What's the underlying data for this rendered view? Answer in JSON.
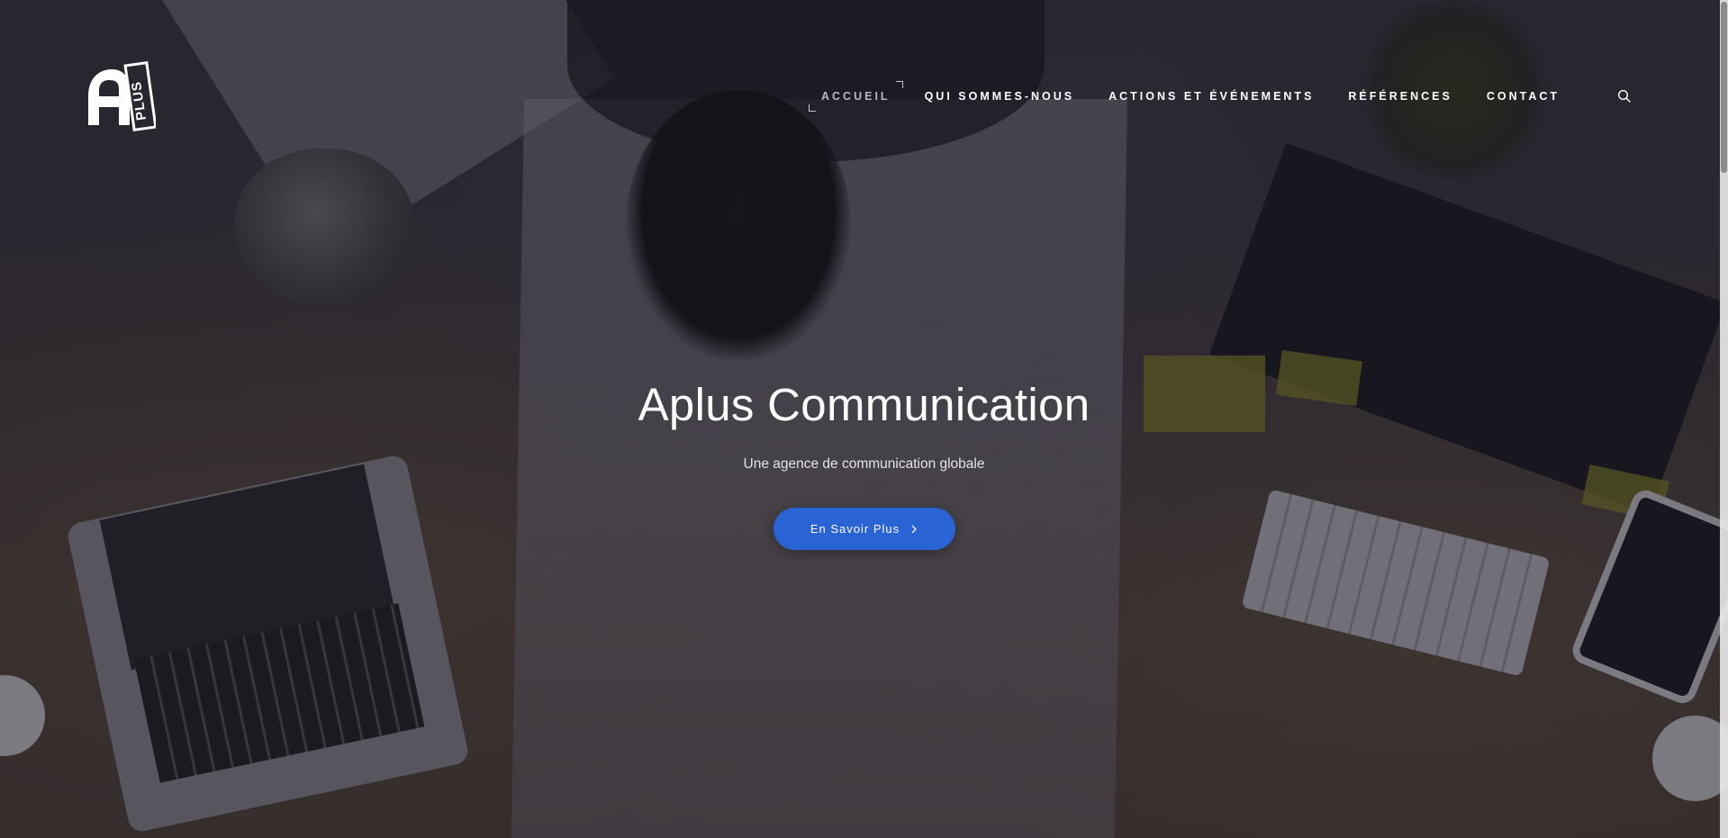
{
  "brand": {
    "logo_text": "PLUS"
  },
  "nav": {
    "items": [
      {
        "label": "ACCUEIL",
        "active": true
      },
      {
        "label": "QUI SOMMES-NOUS",
        "active": false
      },
      {
        "label": "ACTIONS ET ÉVÉNEMENTS",
        "active": false
      },
      {
        "label": "RÉFÉRENCES",
        "active": false
      },
      {
        "label": "CONTACT",
        "active": false
      }
    ],
    "search_icon": "search-icon"
  },
  "hero": {
    "title": "Aplus Communication",
    "subtitle": "Une agence de communication globale",
    "cta_label": "En Savoir Plus",
    "cta_icon": "chevron-right-icon",
    "cta_color": "#2a63d3"
  }
}
